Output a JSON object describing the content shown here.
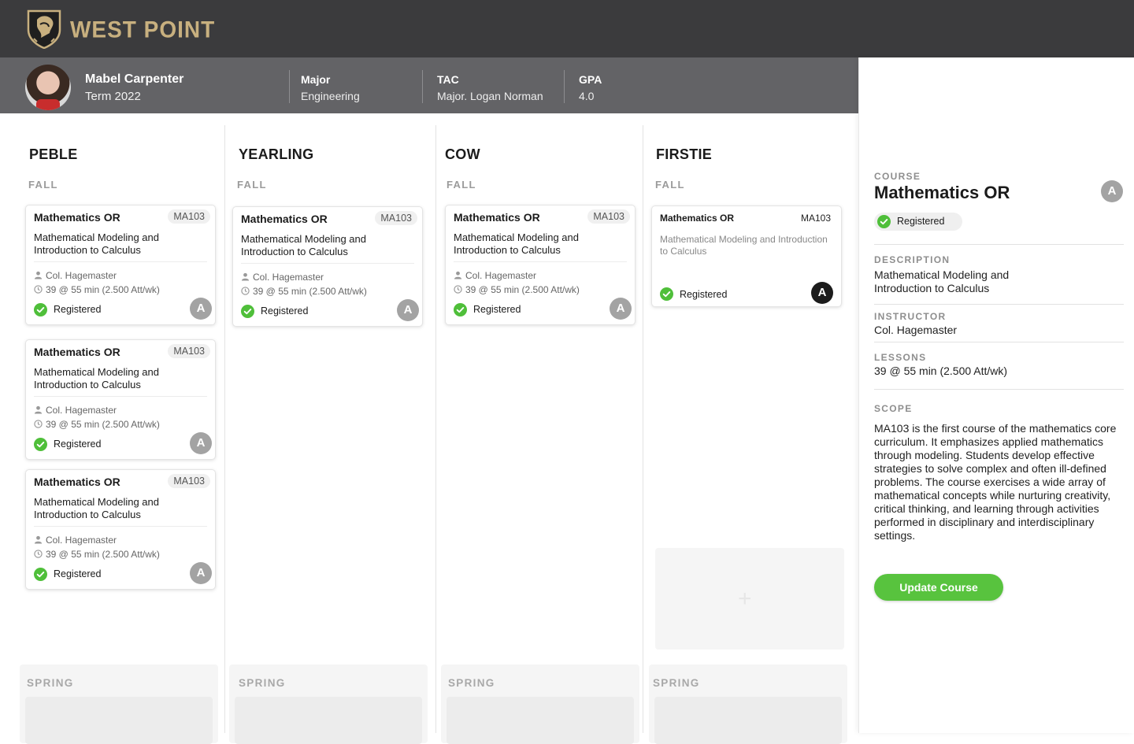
{
  "app": {
    "logo_text": "WEST POINT"
  },
  "profile": {
    "name": "Mabel Carpenter",
    "term": "Term 2022",
    "major_label": "Major",
    "major_value": "Engineering",
    "tac_label": "TAC",
    "tac_value": "Major. Logan Norman",
    "gpa_label": "GPA",
    "gpa_value": "4.0"
  },
  "columns": [
    {
      "title": "PEBLE",
      "fall": "FALL",
      "spring": "SPRING"
    },
    {
      "title": "YEARLING",
      "fall": "FALL",
      "spring": "SPRING"
    },
    {
      "title": "COW",
      "fall": "FALL",
      "spring": "SPRING"
    },
    {
      "title": "FIRSTIE",
      "fall": "FALL",
      "spring": "SPRING"
    }
  ],
  "card": {
    "title": "Mathematics OR",
    "code": "MA103",
    "desc": "Mathematical Modeling and Introduction to Calculus",
    "instructor": "Col. Hagemaster",
    "lessons": "39 @ 55 min (2.500 Att/wk)",
    "status": "Registered",
    "grade": "A"
  },
  "colors": {
    "accent_green": "#58c33e",
    "topbar": "#3b3b3d",
    "gold": "#c8b07f"
  },
  "detail": {
    "course_label": "COURSE",
    "course_title": "Mathematics OR",
    "grade": "A",
    "status": "Registered",
    "description_label": "DESCRIPTION",
    "description": "Mathematical Modeling and Introduction to Calculus",
    "instructor_label": "INSTRUCTOR",
    "instructor": "Col. Hagemaster",
    "lessons_label": "LESSONS",
    "lessons": "39 @ 55 min (2.500 Att/wk)",
    "scope_label": "SCOPE",
    "scope": "MA103 is the first course of the mathematics core curriculum. It emphasizes applied mathematics through modeling. Students develop effective strategies to solve complex and often ill-defined problems. The course exercises a wide array of mathematical concepts while nurturing creativity, critical thinking, and learning through activities performed in disciplinary and interdisciplinary settings.",
    "button": "Update Course"
  }
}
